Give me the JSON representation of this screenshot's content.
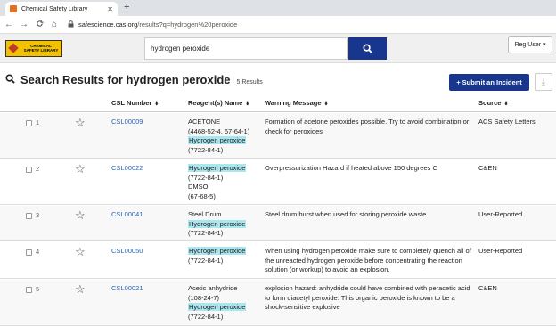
{
  "browser": {
    "tab_title": "Chemical Safety Library",
    "new_tab": "+",
    "url_host": "safescience.cas.org",
    "url_path": "/results?q=hydrogen%20peroxide"
  },
  "header": {
    "logo_line1": "CHEMICAL",
    "logo_line2": "SAFETY LIBRARY",
    "search_value": "hydrogen peroxide",
    "user_label": "Reg User ▾"
  },
  "results": {
    "title": "Search Results for hydrogen peroxide",
    "count": "5 Results",
    "submit_label": "+ Submit an Incident"
  },
  "columns": {
    "csl": "CSL Number",
    "reagents": "Reagent(s) Name",
    "warning": "Warning Message",
    "source": "Source"
  },
  "rows": [
    {
      "index": "1",
      "csl": "CSL00009",
      "reagents": [
        "ACETONE",
        "(4468-52-4, 67-64-1)",
        "Hydrogen peroxide",
        "(7722-84-1)"
      ],
      "warning": "Formation of acetone peroxides possible. Try to avoid combination or check for peroxides",
      "source": "ACS Safety Letters"
    },
    {
      "index": "2",
      "csl": "CSL00022",
      "reagents": [
        "Hydrogen peroxide",
        "(7722-84-1)",
        "DMSO",
        "(67-68-5)"
      ],
      "warning": "Overpressurization Hazard if heated above 150 degrees C",
      "source": "C&EN"
    },
    {
      "index": "3",
      "csl": "CSL00041",
      "reagents": [
        "Steel Drum",
        "Hydrogen peroxide",
        "(7722-84-1)"
      ],
      "warning": "Steel drum burst when used for storing peroxide waste",
      "source": "User-Reported"
    },
    {
      "index": "4",
      "csl": "CSL00050",
      "reagents": [
        "Hydrogen peroxide",
        "(7722-84-1)"
      ],
      "warning": "When using hydrogen peroxide make sure to completely quench all of the unreacted hydrogen peroxide before concentrating the reaction solution (or workup) to avoid an explosion.",
      "source": "User-Reported"
    },
    {
      "index": "5",
      "csl": "CSL00021",
      "reagents": [
        "Acetic anhydride",
        "(108-24-7)",
        "Hydrogen peroxide",
        "(7722-84-1)"
      ],
      "warning": "explosion hazard: anhydride could have combined with peracetic acid to form diacetyl peroxide. This organic peroxide is known to be a shock-sensitive explosive",
      "source": "C&EN"
    }
  ],
  "icons": {
    "back": "←",
    "forward": "→",
    "reload": "C",
    "home": "⌂",
    "lock": "🔒",
    "search": "🔍",
    "star": "☆",
    "download": "⤓",
    "sort": "⬍"
  }
}
